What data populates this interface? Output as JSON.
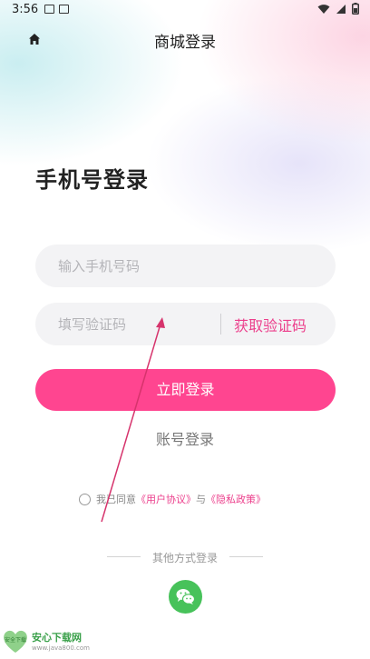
{
  "status_bar": {
    "time": "3:56"
  },
  "header": {
    "title": "商城登录"
  },
  "login": {
    "heading": "手机号登录",
    "phone_placeholder": "输入手机号码",
    "code_placeholder": "填写验证码",
    "get_code_label": "获取验证码",
    "submit_label": "立即登录",
    "account_login_label": "账号登录"
  },
  "agreement": {
    "prefix": "我已同意",
    "user_agreement": "《用户协议》",
    "connector": "与",
    "privacy_policy": "《隐私政策》"
  },
  "other_login": {
    "label": "其他方式登录"
  },
  "watermark": {
    "badge": "安全下载",
    "title": "安心下载网",
    "url": "www.java800.com"
  },
  "colors": {
    "accent": "#ff4590",
    "link": "#ec3f8c",
    "wechat": "#47c25a"
  }
}
